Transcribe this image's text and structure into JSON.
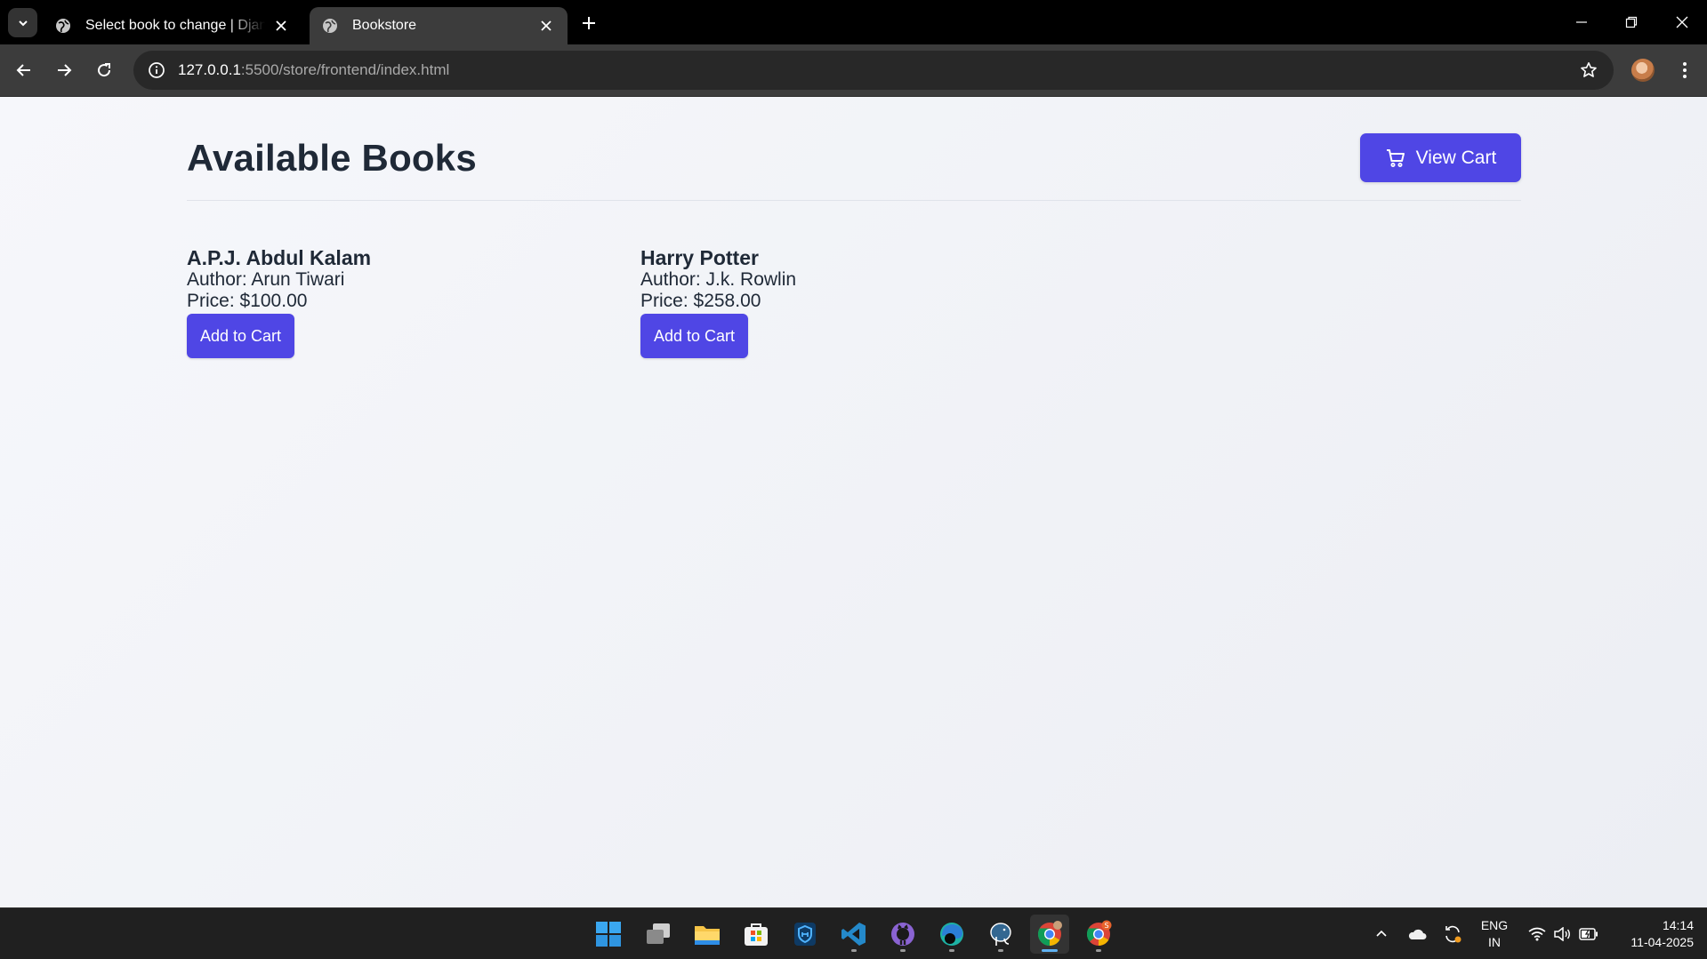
{
  "browser": {
    "tabs": [
      {
        "title": "Select book to change | Django site admin",
        "active": false
      },
      {
        "title": "Bookstore",
        "active": true
      }
    ],
    "url_host": "127.0.0.1",
    "url_rest": ":5500/store/frontend/index.html"
  },
  "page": {
    "title": "Available Books",
    "view_cart_label": "View Cart",
    "books": [
      {
        "title": "A.P.J. Abdul Kalam",
        "author": "Author: Arun Tiwari",
        "price": "Price: $100.00",
        "button": "Add to Cart"
      },
      {
        "title": "Harry Potter",
        "author": "Author: J.k. Rowlin",
        "price": "Price: $258.00",
        "button": "Add to Cart"
      }
    ]
  },
  "taskbar": {
    "apps": [
      "windows-start-icon",
      "task-view-icon",
      "file-explorer-icon",
      "microsoft-store-icon",
      "app-shield-icon",
      "vscode-icon",
      "github-icon",
      "edge-icon",
      "postgresql-icon",
      "chrome-icon",
      "chrome-profile-icon"
    ],
    "language": {
      "line1": "ENG",
      "line2": "IN"
    },
    "clock": {
      "time": "14:14",
      "date": "11-04-2025"
    }
  },
  "colors": {
    "accent": "#4f46e5",
    "text": "#1f2937",
    "page_bg": "#f3f4f6"
  }
}
